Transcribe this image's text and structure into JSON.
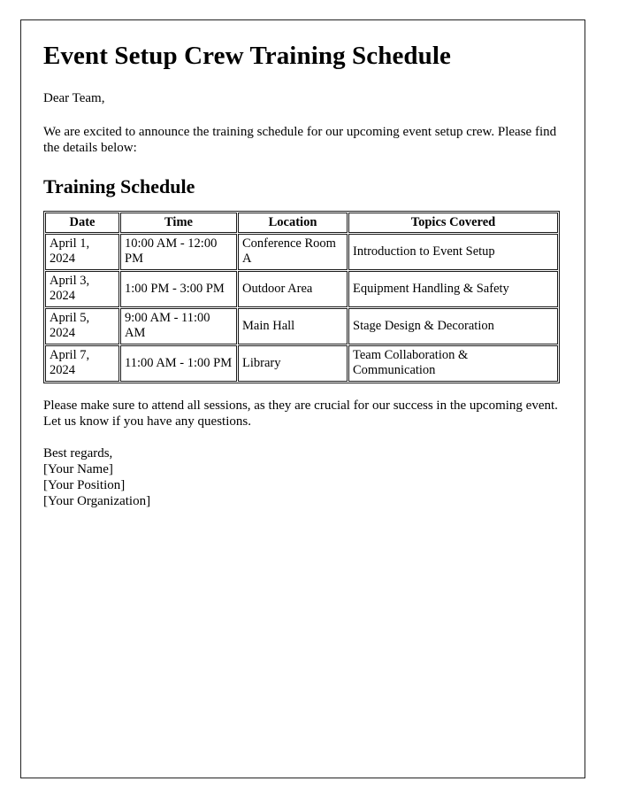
{
  "document": {
    "title": "Event Setup Crew Training Schedule",
    "greeting": "Dear Team,",
    "intro": "We are excited to announce the training schedule for our upcoming event setup crew. Please find the details below:",
    "section_title": "Training Schedule",
    "closing": "Please make sure to attend all sessions, as they are crucial for our success in the upcoming event. Let us know if you have any questions.",
    "signature": {
      "regards": "Best regards,",
      "name": "[Your Name]",
      "position": "[Your Position]",
      "organization": "[Your Organization]"
    }
  },
  "table": {
    "headers": [
      "Date",
      "Time",
      "Location",
      "Topics Covered"
    ],
    "rows": [
      {
        "date": "April 1, 2024",
        "time": "10:00 AM - 12:00 PM",
        "location": "Conference Room A",
        "topics": "Introduction to Event Setup"
      },
      {
        "date": "April 3, 2024",
        "time": "1:00 PM - 3:00 PM",
        "location": "Outdoor Area",
        "topics": "Equipment Handling & Safety"
      },
      {
        "date": "April 5, 2024",
        "time": "9:00 AM - 11:00 AM",
        "location": "Main Hall",
        "topics": "Stage Design & Decoration"
      },
      {
        "date": "April 7, 2024",
        "time": "11:00 AM - 1:00 PM",
        "location": "Library",
        "topics": "Team Collaboration & Communication"
      }
    ]
  },
  "colors": {
    "text": "#000000",
    "page_border": "#222222",
    "table_border": "#1a1a1a",
    "background": "#ffffff"
  }
}
